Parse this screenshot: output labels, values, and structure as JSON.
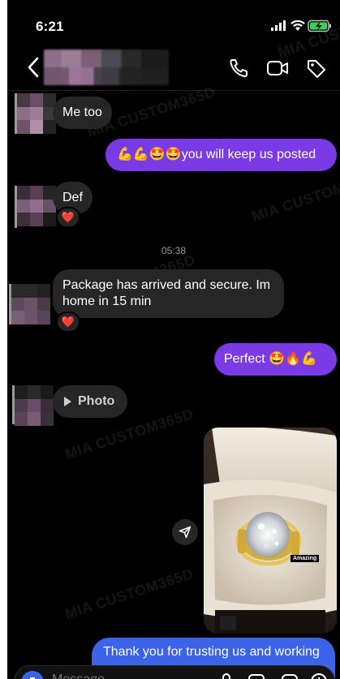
{
  "status_bar": {
    "time": "6:21"
  },
  "watermark": "MIA CUSTOM365D",
  "messages": {
    "m1": {
      "text": "Me too"
    },
    "m2": {
      "text": "💪💪🤩🤩you will keep us posted"
    },
    "m3": {
      "text": "Def",
      "reaction": "❤️"
    },
    "timestamp": "05:38",
    "m4": {
      "text": "Package has arrived and secure. Im home in 15 min",
      "reaction": "❤️"
    },
    "m5": {
      "text": "Perfect 🤩🔥💪"
    },
    "m6": {
      "label": "Photo"
    },
    "m7": {
      "image_caption": "Amazing"
    },
    "m8": {
      "text": "Thank you for trusting us and working"
    }
  },
  "composer": {
    "placeholder": "Message"
  },
  "colors": {
    "background": "#000000",
    "incoming": "#262626",
    "outgoing": "#7a3ae6",
    "outgoing_last": "#3b63e8"
  }
}
